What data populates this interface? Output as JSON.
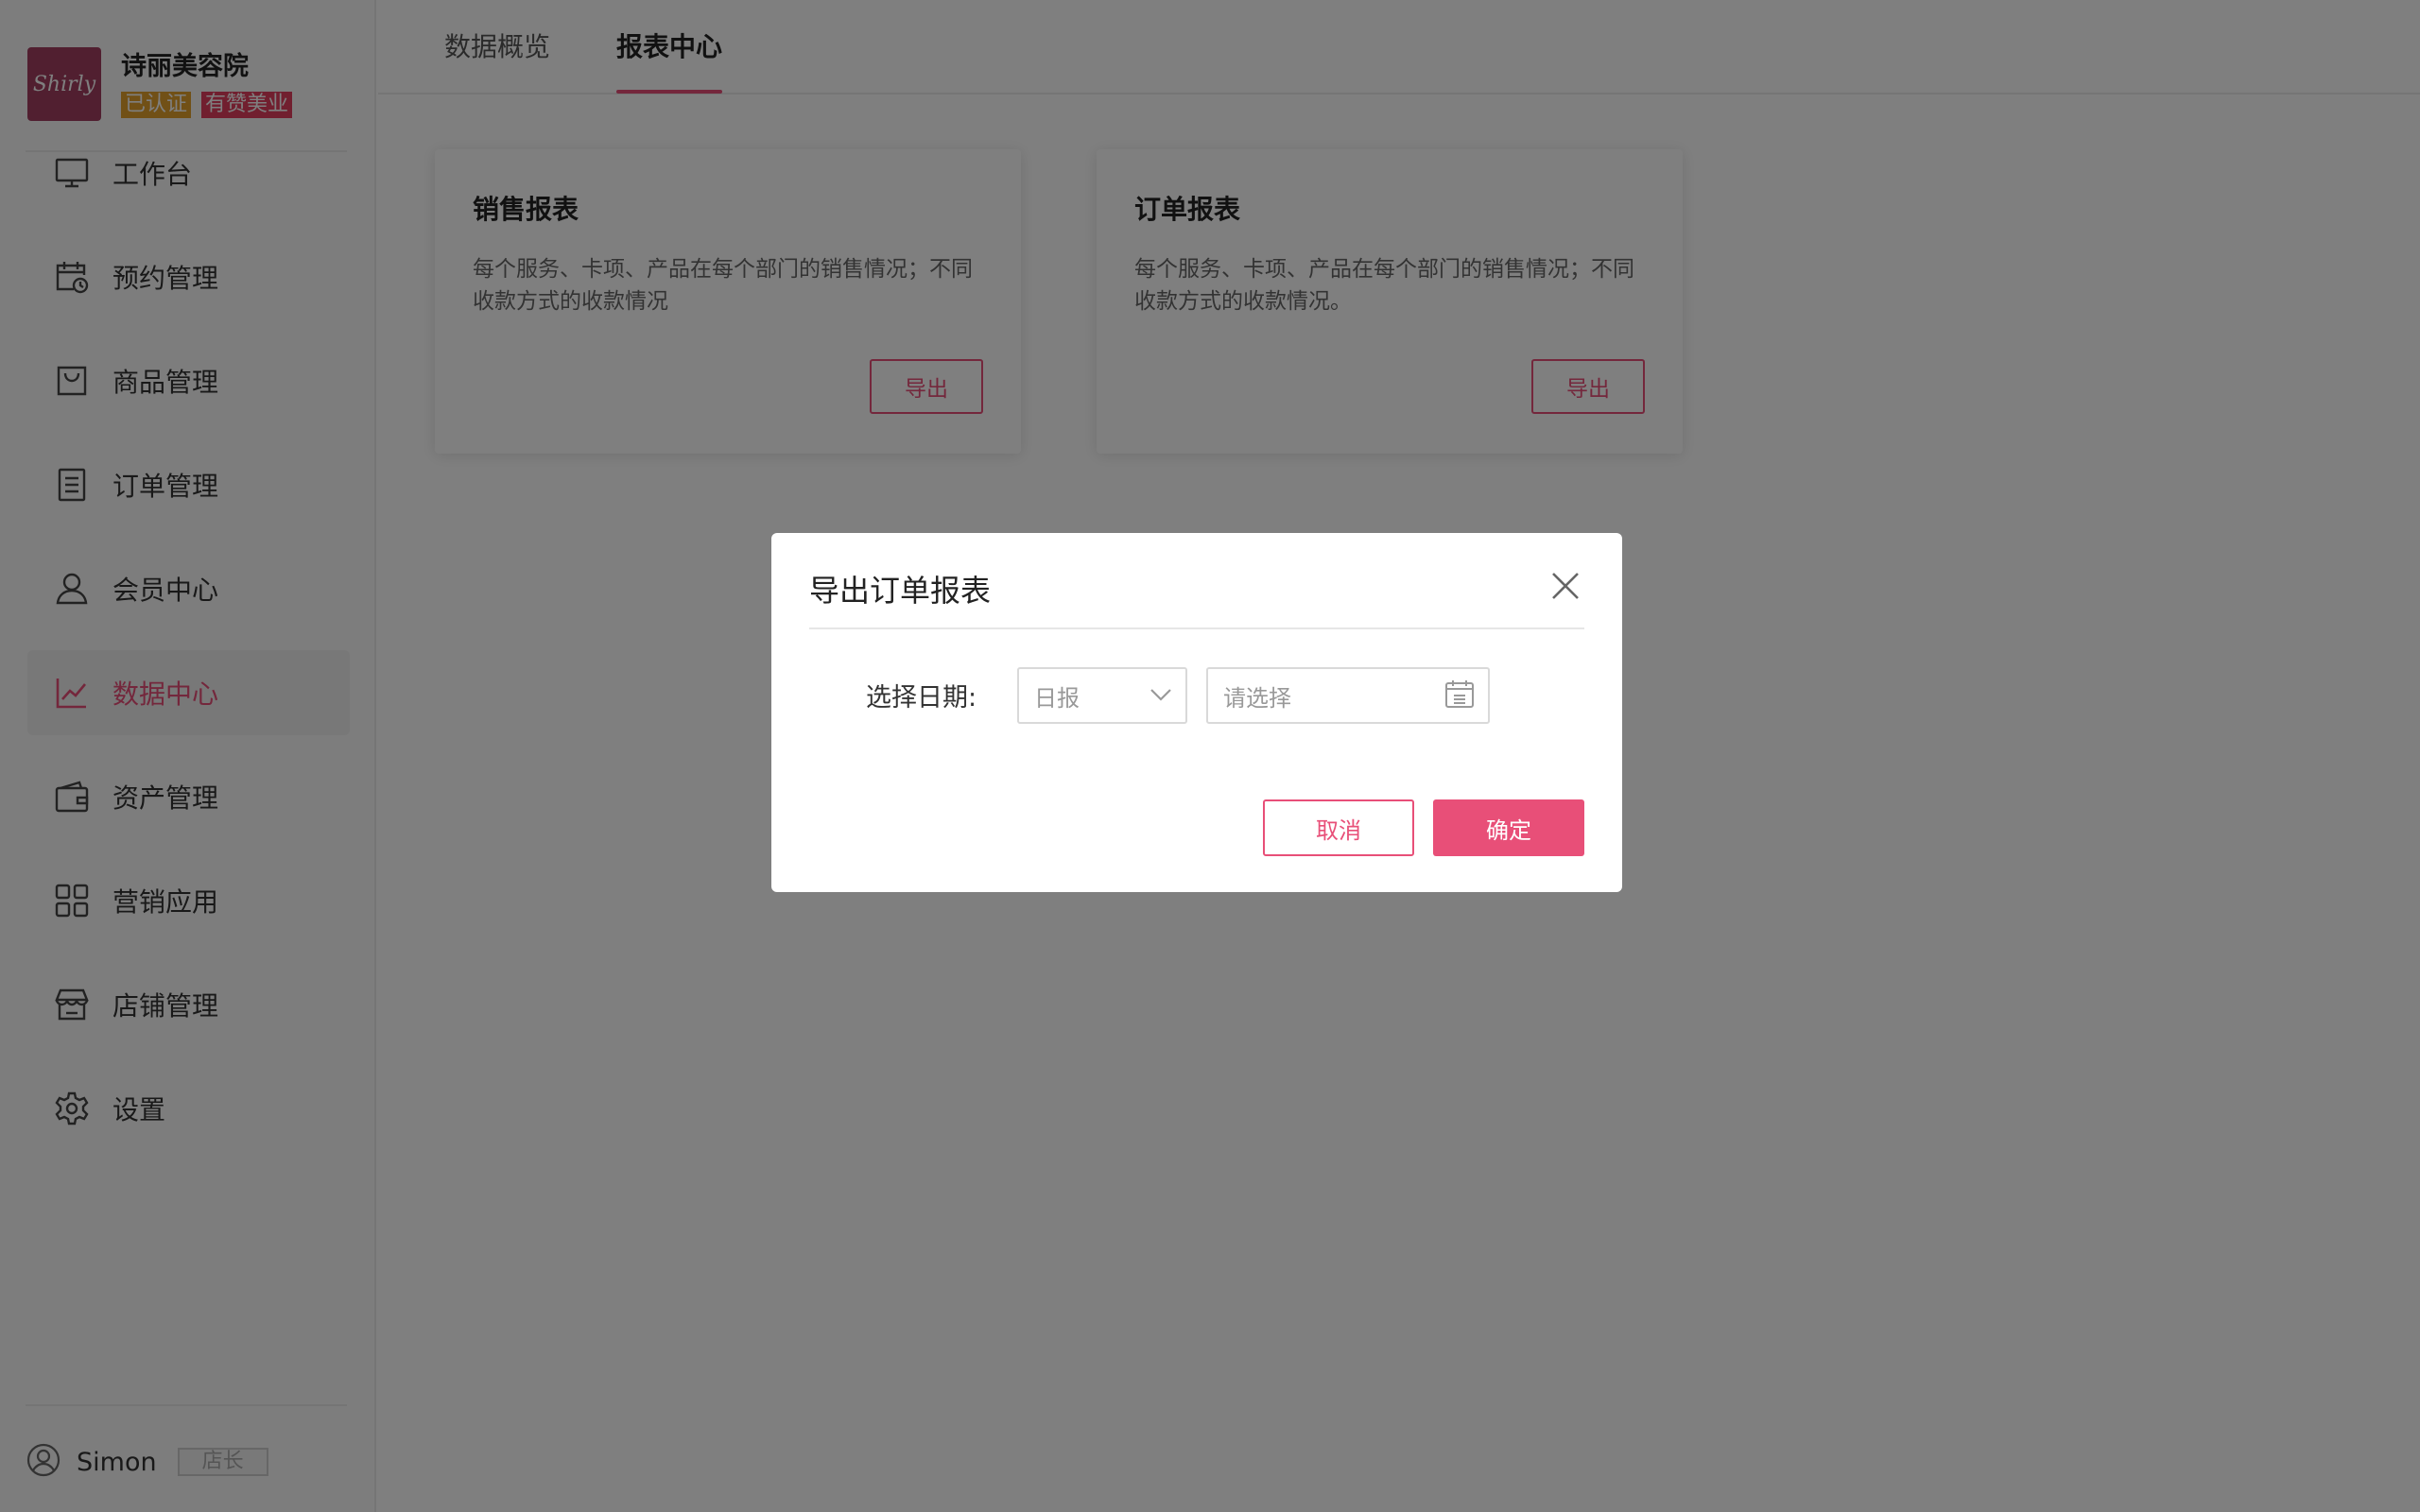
{
  "brand": {
    "logo_text": "Shirly",
    "name": "诗丽美容院",
    "badge_verified": "已认证",
    "badge_partner": "有赞美业"
  },
  "sidebar": {
    "items": [
      {
        "label": "工作台",
        "icon": "monitor-icon"
      },
      {
        "label": "预约管理",
        "icon": "calendar-clock-icon"
      },
      {
        "label": "商品管理",
        "icon": "shopping-bag-icon"
      },
      {
        "label": "订单管理",
        "icon": "document-list-icon"
      },
      {
        "label": "会员中心",
        "icon": "user-icon"
      },
      {
        "label": "数据中心",
        "icon": "line-chart-icon",
        "active": true
      },
      {
        "label": "资产管理",
        "icon": "wallet-icon"
      },
      {
        "label": "营销应用",
        "icon": "grid-apps-icon"
      },
      {
        "label": "店铺管理",
        "icon": "store-icon"
      },
      {
        "label": "设置",
        "icon": "gear-icon"
      }
    ]
  },
  "user": {
    "name": "Simon",
    "role": "店长",
    "icon": "user-circle-icon"
  },
  "tabs": [
    {
      "label": "数据概览"
    },
    {
      "label": "报表中心",
      "active": true
    }
  ],
  "cards": [
    {
      "title": "销售报表",
      "desc": "每个服务、卡项、产品在每个部门的销售情况；不同收款方式的收款情况",
      "button": "导出"
    },
    {
      "title": "订单报表",
      "desc": "每个服务、卡项、产品在每个部门的销售情况；不同收款方式的收款情况。",
      "button": "导出"
    }
  ],
  "modal": {
    "title": "导出订单报表",
    "field_label": "选择日期:",
    "select_value": "日报",
    "date_placeholder": "请选择",
    "cancel": "取消",
    "confirm": "确定"
  },
  "colors": {
    "accent": "#e84f78",
    "badge_gold": "#e2a12d",
    "badge_red": "#e23e5f",
    "overlay": "rgba(0,0,0,0.5)"
  }
}
